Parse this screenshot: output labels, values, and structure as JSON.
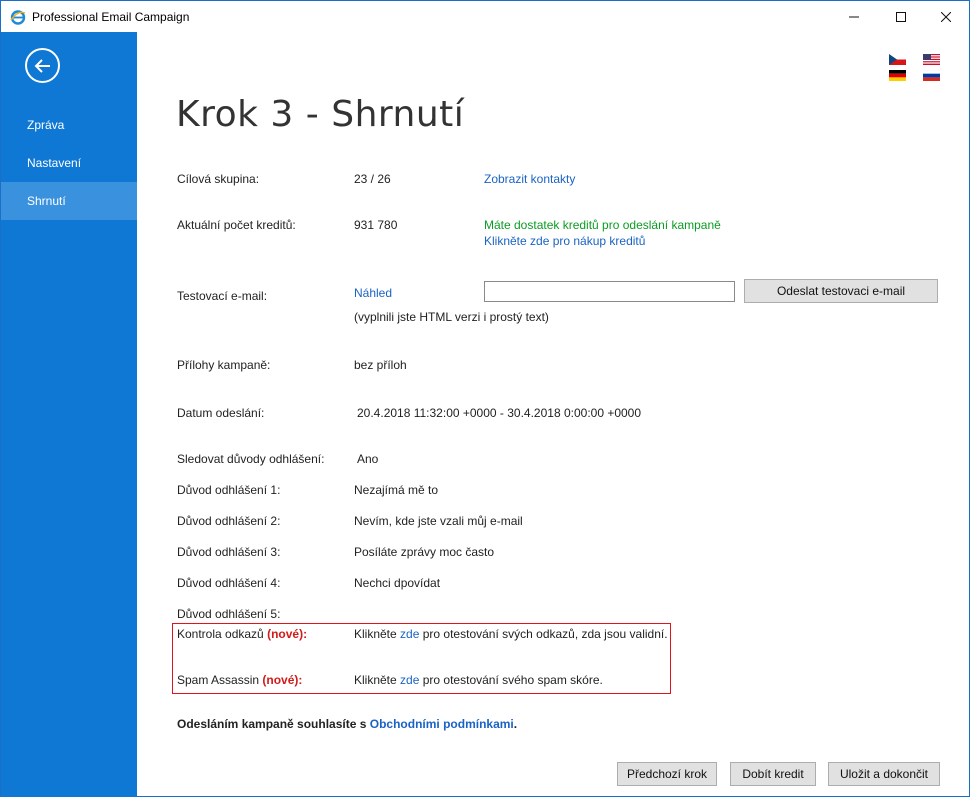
{
  "window": {
    "title": "Professional Email Campaign",
    "min_icon": "minimize-icon",
    "max_icon": "maximize-icon",
    "close_icon": "close-icon"
  },
  "sidebar": {
    "back_icon": "back-arrow-icon",
    "items": [
      {
        "label": "Zpráva",
        "active": false
      },
      {
        "label": "Nastavení",
        "active": false
      },
      {
        "label": "Shrnutí",
        "active": true
      }
    ],
    "color": "#0f78d4",
    "active_color": "#3a92df"
  },
  "languages": [
    "czech-flag-icon",
    "english-flag-icon",
    "german-flag-icon",
    "russian-flag-icon"
  ],
  "page": {
    "title": "Krok 3 - Shrnutí"
  },
  "summary": {
    "target_group": {
      "label": "Cílová skupina:",
      "value": "23 / 26",
      "link": "Zobrazit kontakty"
    },
    "credits": {
      "label": "Aktuální počet kreditů:",
      "value": "931 780",
      "status": "Máte dostatek kreditů pro odeslání kampaně",
      "buy_link": "Klikněte zde pro nákup kreditů"
    },
    "test_email": {
      "label": "Testovací e-mail:",
      "preview_link": "Náhled",
      "value": "",
      "placeholder": "",
      "note": "(vyplnili jste HTML verzi i prostý text)",
      "send_button": "Odeslat testovaci e-mail"
    },
    "attachments": {
      "label": "Přílohy kampaně:",
      "value": "bez příloh"
    },
    "send_date": {
      "label": "Datum odeslání:",
      "value": "20.4.2018 11:32:00 +0000 - 30.4.2018 0:00:00 +0000"
    },
    "track_unsubscribe": {
      "label": "Sledovat důvody odhlášení:",
      "value": "Ano"
    },
    "reasons": [
      {
        "label": "Důvod odhlášení 1:",
        "value": "Nezajímá mě to"
      },
      {
        "label": "Důvod odhlášení 2:",
        "value": "Nevím, kde jste vzali můj e-mail"
      },
      {
        "label": "Důvod odhlášení 3:",
        "value": "Posíláte zprávy moc často"
      },
      {
        "label": "Důvod odhlášení 4:",
        "value": "Nechci dpovídat"
      },
      {
        "label": "Důvod odhlášení 5:",
        "value": ""
      }
    ],
    "link_check": {
      "label": "Kontrola odkazů",
      "new_tag": "(nové):",
      "text_before": "Klikněte",
      "link": "zde",
      "text_after": "pro otestování svých odkazů, zda jsou validní."
    },
    "spam_assassin": {
      "label": "Spam Assassin",
      "new_tag": "(nové):",
      "text_before": "Klikněte",
      "link": "zde",
      "text_after": "pro otestování svého spam skóre."
    }
  },
  "terms": {
    "text": "Odesláním kampaně souhlasíte s",
    "link": "Obchodními podmínkami",
    "suffix": "."
  },
  "footer": {
    "prev_button": "Předchozí krok",
    "credit_button": "Dobít kredit",
    "finish_button": "Uložit a dokončit"
  }
}
